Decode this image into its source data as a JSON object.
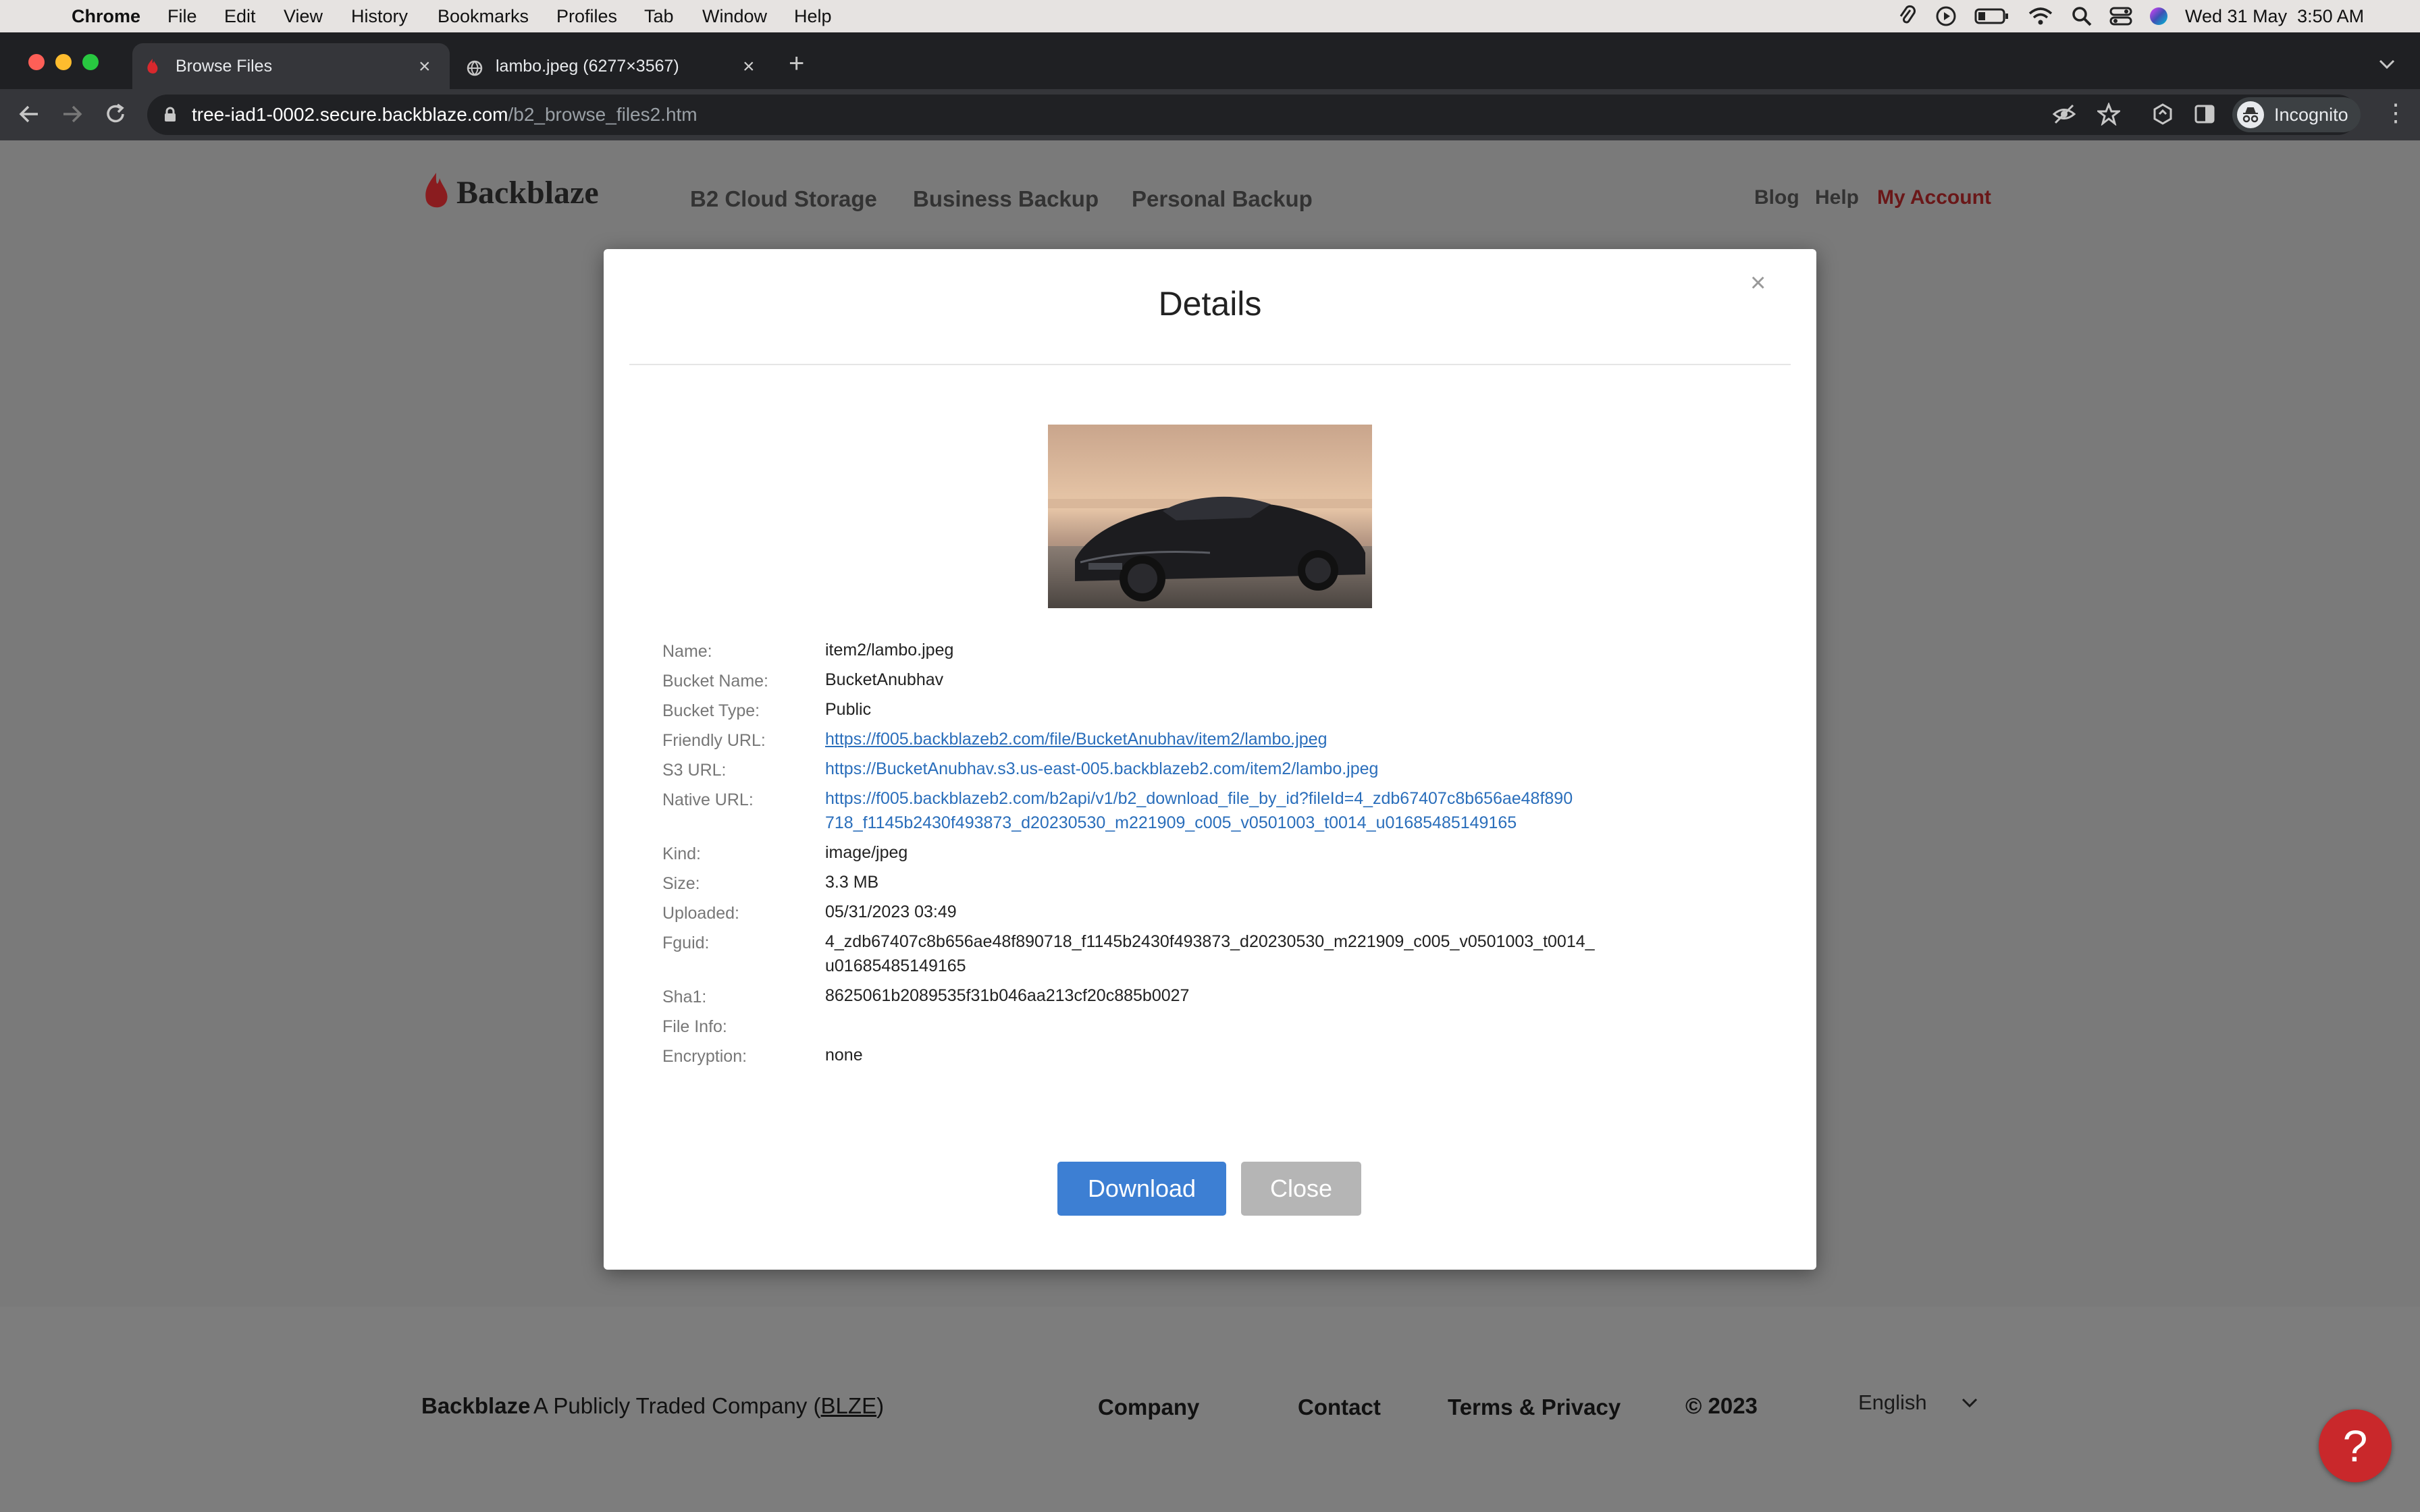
{
  "menubar": {
    "app": "Chrome",
    "items": [
      "File",
      "Edit",
      "View",
      "History",
      "Bookmarks",
      "Profiles",
      "Tab",
      "Window",
      "Help"
    ],
    "datetime": "Wed 31 May  3:50 AM"
  },
  "tabs": [
    {
      "title": "Browse Files"
    },
    {
      "title": "lambo.jpeg (6277×3567)"
    }
  ],
  "omnibox": {
    "host": "tree-iad1-0002.secure.backblaze.com",
    "path": "/b2_browse_files2.htm",
    "profile": "Incognito"
  },
  "site": {
    "logo": "Backblaze",
    "nav": [
      "B2 Cloud Storage",
      "Business Backup",
      "Personal Backup"
    ],
    "nav_right": [
      "Blog",
      "Help",
      "My Account"
    ],
    "accent": "#c7282c"
  },
  "modal": {
    "title": "Details",
    "close_x": "×",
    "fields": [
      {
        "label": "Name:",
        "value": "item2/lambo.jpeg"
      },
      {
        "label": "Bucket Name:",
        "value": "BucketAnubhav"
      },
      {
        "label": "Bucket Type:",
        "value": "Public"
      },
      {
        "label": "Friendly URL:",
        "value": "https://f005.backblazeb2.com/file/BucketAnubhav/item2/lambo.jpeg"
      },
      {
        "label": "S3 URL:",
        "value": "https://BucketAnubhav.s3.us-east-005.backblazeb2.com/item2/lambo.jpeg"
      },
      {
        "label": "Native URL:",
        "value_line1": "https://f005.backblazeb2.com/b2api/v1/b2_download_file_by_id?fileId=4_zdb67407c8b656ae48f890",
        "value_line2": "718_f1145b2430f493873_d20230530_m221909_c005_v0501003_t0014_u01685485149165"
      },
      {
        "label": "Kind:",
        "value": "image/jpeg"
      },
      {
        "label": "Size:",
        "value": "3.3 MB"
      },
      {
        "label": "Uploaded:",
        "value": "05/31/2023 03:49"
      },
      {
        "label": "Fguid:",
        "value_line1": "4_zdb67407c8b656ae48f890718_f1145b2430f493873_d20230530_m221909_c005_v0501003_t0014_",
        "value_line2": "u01685485149165"
      },
      {
        "label": "Sha1:",
        "value": "8625061b2089535f31b046aa213cf20c885b0027"
      },
      {
        "label": "File Info:",
        "value": ""
      },
      {
        "label": "Encryption:",
        "value": "none"
      }
    ],
    "download_label": "Download",
    "close_label": "Close"
  },
  "footer": {
    "brand": "Backblaze",
    "tagline_pre": "A Publicly Traded Company (",
    "ticker": "BLZE",
    "tagline_post": ")",
    "links": [
      "Company",
      "Contact",
      "Terms & Privacy"
    ],
    "copyright": "© 2023",
    "language": "English"
  },
  "help_icon": "?"
}
